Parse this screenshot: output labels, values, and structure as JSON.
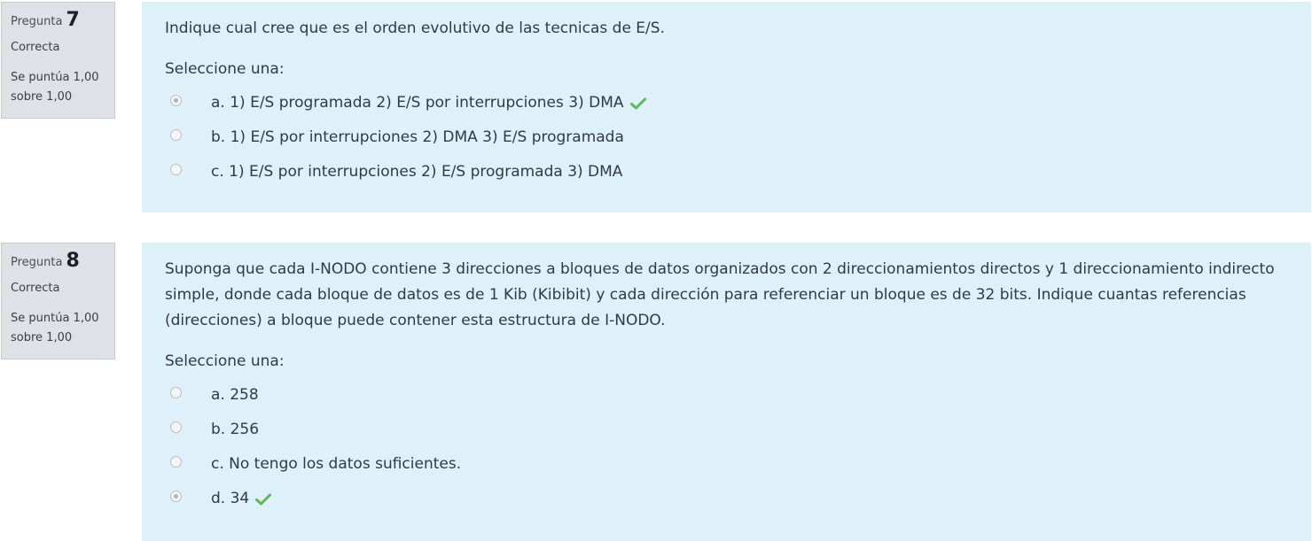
{
  "questions": [
    {
      "label": "Pregunta",
      "number": "7",
      "state": "Correcta",
      "grade_line1": "Se puntúa 1,00",
      "grade_line2": "sobre 1,00",
      "text": "Indique cual cree que es el orden evolutivo de las tecnicas de E/S.",
      "prompt": "Seleccione una:",
      "answers": [
        {
          "text": "a. 1) E/S programada 2) E/S por interrupciones 3) DMA",
          "checked": true,
          "correct": true
        },
        {
          "text": "b. 1) E/S por interrupciones 2) DMA 3) E/S programada",
          "checked": false,
          "correct": false
        },
        {
          "text": "c. 1) E/S por interrupciones 2) E/S programada 3) DMA",
          "checked": false,
          "correct": false
        }
      ]
    },
    {
      "label": "Pregunta",
      "number": "8",
      "state": "Correcta",
      "grade_line1": "Se puntúa 1,00",
      "grade_line2": "sobre 1,00",
      "text": "Suponga que cada I-NODO contiene 3 direcciones a bloques de datos organizados con 2 direccionamientos directos y 1 direccionamiento indirecto simple, donde cada bloque de datos es de 1 Kib (Kibibit) y cada dirección para referenciar un bloque es de 32 bits. Indique cuantas referencias (direcciones) a bloque puede contener esta estructura de I-NODO.",
      "prompt": "Seleccione una:",
      "answers": [
        {
          "text": "a. 258",
          "checked": false,
          "correct": false
        },
        {
          "text": "b. 256",
          "checked": false,
          "correct": false
        },
        {
          "text": "c. No tengo los datos suficientes.",
          "checked": false,
          "correct": false
        },
        {
          "text": "d. 34",
          "checked": true,
          "correct": true
        }
      ]
    }
  ],
  "colors": {
    "info_bg": "#dee2e6",
    "content_bg": "#def1f8",
    "correct_check": "#5cb85c"
  },
  "icons": {
    "correct": "checkmark-icon",
    "radio": "radio-icon"
  }
}
